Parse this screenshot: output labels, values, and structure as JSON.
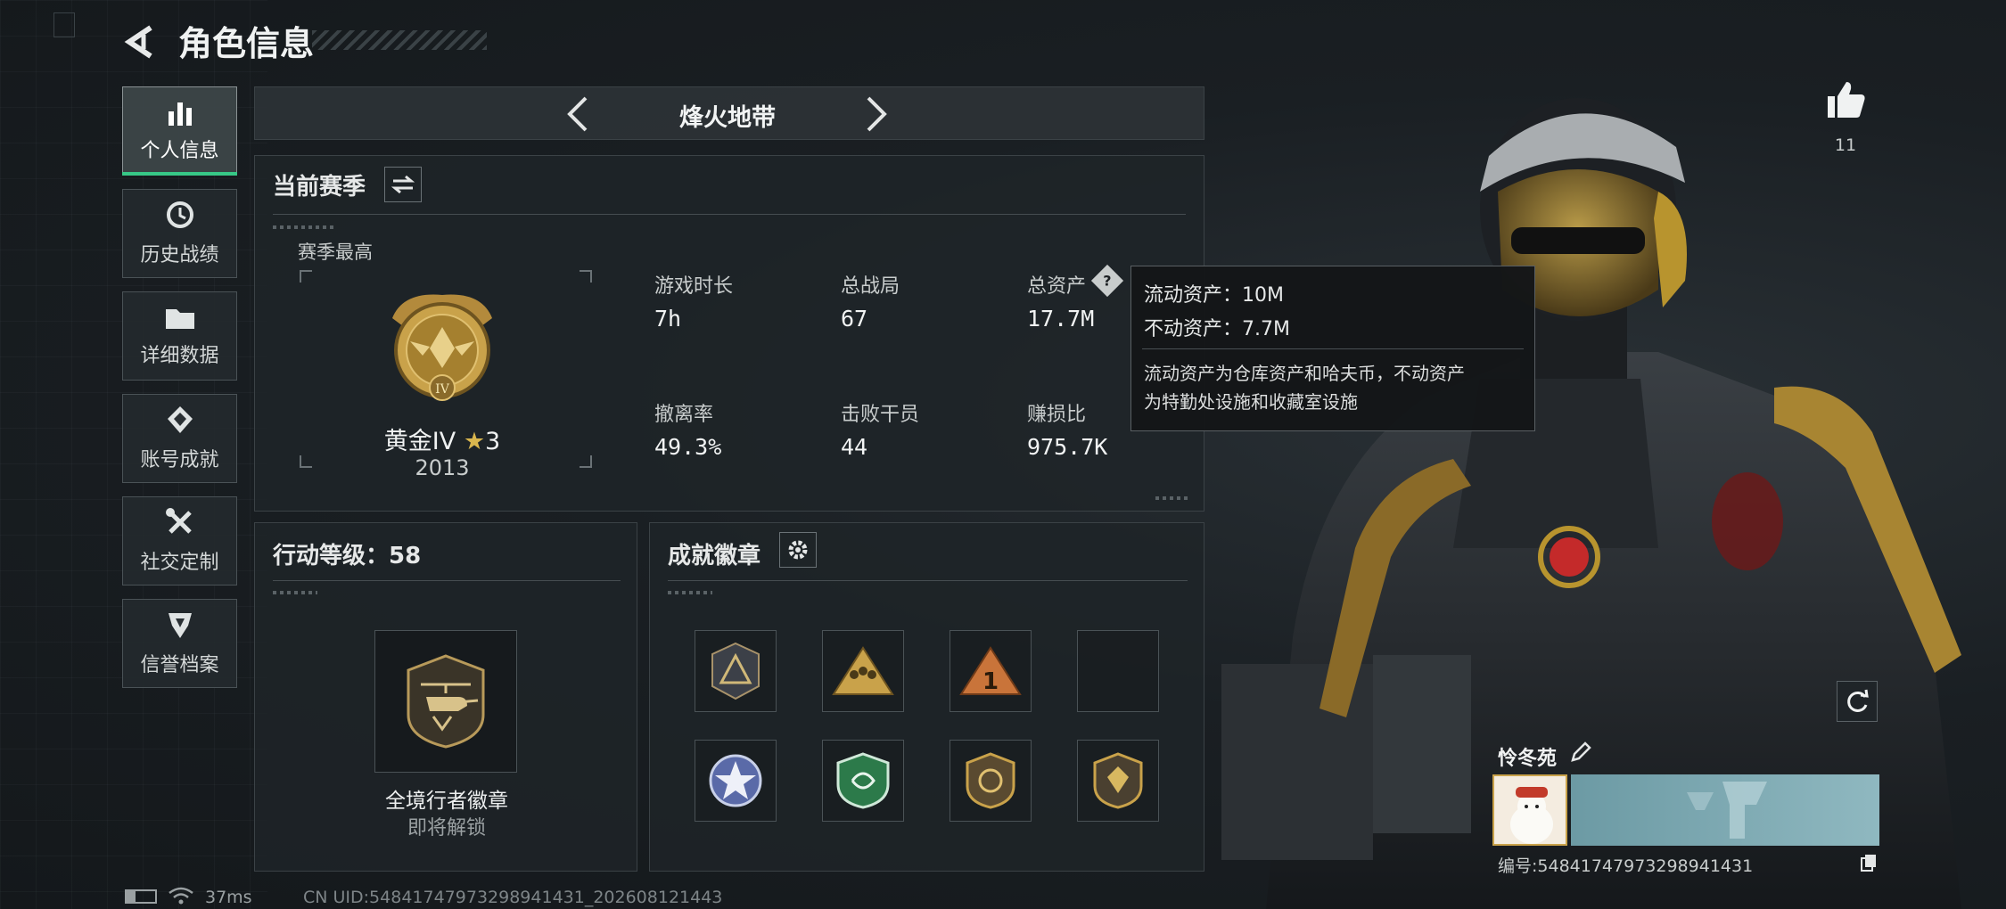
{
  "header": {
    "title": "角色信息"
  },
  "sidebar": {
    "items": [
      {
        "label": "个人信息",
        "icon": "bar-chart-icon",
        "active": true
      },
      {
        "label": "历史战绩",
        "icon": "history-icon",
        "active": false
      },
      {
        "label": "详细数据",
        "icon": "folder-icon",
        "active": false
      },
      {
        "label": "账号成就",
        "icon": "achievement-icon",
        "active": false
      },
      {
        "label": "社交定制",
        "icon": "tools-icon",
        "active": false
      },
      {
        "label": "信誉档案",
        "icon": "reputation-icon",
        "active": false
      }
    ]
  },
  "mode_selector": {
    "label": "烽火地带"
  },
  "season": {
    "title": "当前赛季",
    "best_label": "赛季最高",
    "rank_name": "黄金IV",
    "rank_stars": "3",
    "rank_score": "2013",
    "rank_numeral": "IV",
    "stats": [
      {
        "label": "游戏时长",
        "value": "7h"
      },
      {
        "label": "总战局",
        "value": "67"
      },
      {
        "label": "总资产",
        "value": "17.7M"
      },
      {
        "label": "撤离率",
        "value": "49.3%"
      },
      {
        "label": "击败干员",
        "value": "44"
      },
      {
        "label": "赚损比",
        "value": "975.7K"
      }
    ]
  },
  "tooltip": {
    "liquid": "流动资产：10M",
    "fixed": "不动资产：7.7M",
    "desc_line1": "流动资产为仓库资产和哈夫币，不动资产",
    "desc_line2": "为特勤处设施和收藏室设施"
  },
  "action_level": {
    "label": "行动等级：58",
    "badge_name": "全境行者徽章",
    "badge_status": "即将解锁"
  },
  "achievements": {
    "title": "成就徽章"
  },
  "likes": {
    "count": "11"
  },
  "player": {
    "name": "怜冬苑",
    "id_line": "编号:5484174797329894143​1"
  },
  "status_bar": {
    "ping": "37ms",
    "uid": "CN UID:5484174797329894143​1_202608121443"
  },
  "colors": {
    "accent_green": "#37c887",
    "gold": "#c9a24a",
    "panel_bg": "#1e2428"
  }
}
